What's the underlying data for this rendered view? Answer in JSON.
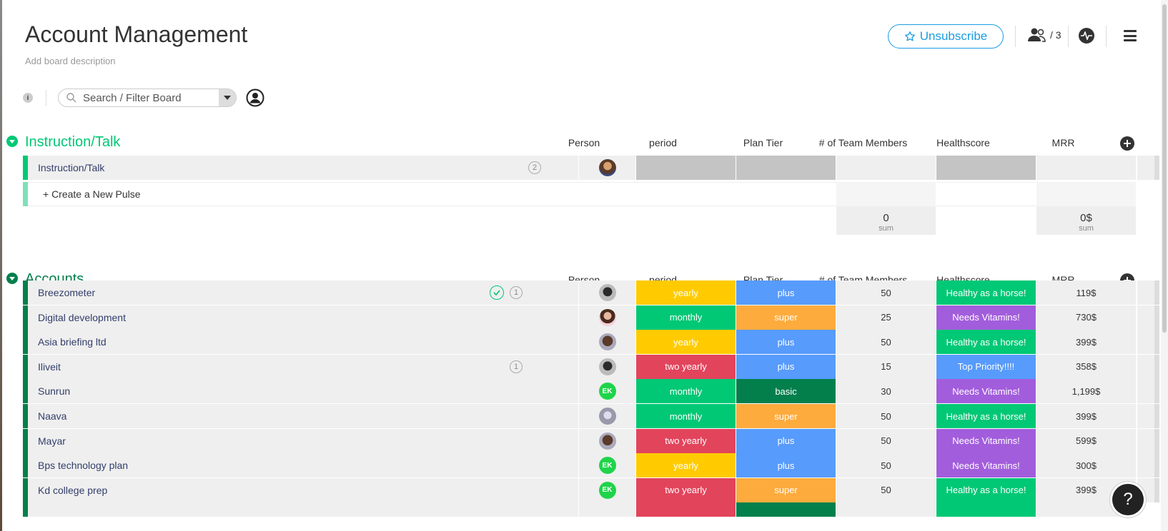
{
  "board": {
    "title": "Account Management",
    "description": "Add board description",
    "unsubscribe_label": "Unsubscribe",
    "members_count": "/ 3",
    "search_placeholder": "Search / Filter Board",
    "info_badge": "i"
  },
  "columns": [
    "Person",
    "period",
    "Plan Tier",
    "# of Team Members",
    "Healthscore",
    "MRR"
  ],
  "colors": {
    "yearly": "#ffcb00",
    "monthly": "#00c875",
    "two yearly": "#e2445c",
    "plus": "#579bfc",
    "super": "#fdab3d",
    "basic": "#037f4c",
    "Healthy as a horse!": "#00c875",
    "Needs Vitamins!": "#a25ddc",
    "Top Priority!!!!": "#579bfc",
    "group1": "#00c875",
    "group2": "#037f4c",
    "empty": "#c4c4c4"
  },
  "groups": [
    {
      "title": "Instruction/Talk",
      "rows": [
        {
          "name": "Instruction/Talk",
          "updates": "2",
          "person": "photo",
          "period": "",
          "tier": "",
          "team": "",
          "health": "",
          "mrr": ""
        }
      ],
      "new_pulse": "+ Create a New Pulse",
      "sums": {
        "team": "0",
        "mrr": "0$",
        "label": "sum"
      }
    },
    {
      "title": "Accounts",
      "rows": [
        {
          "name": "Breezometer",
          "updates": "1",
          "done": true,
          "person": "photo",
          "period": "yearly",
          "tier": "plus",
          "team": "50",
          "health": "Healthy as a horse!",
          "mrr": "119$"
        },
        {
          "name": "Digital development",
          "person": "photo",
          "period": "monthly",
          "tier": "super",
          "team": "25",
          "health": "Needs Vitamins!",
          "mrr": "730$"
        },
        {
          "name": "Asia briefing ltd",
          "person": "photo",
          "period": "yearly",
          "tier": "plus",
          "team": "50",
          "health": "Healthy as a horse!",
          "mrr": "399$"
        },
        {
          "name": "Iliveit",
          "updates": "1",
          "person": "photo",
          "period": "two yearly",
          "tier": "plus",
          "team": "15",
          "health": "Top Priority!!!!",
          "mrr": "358$"
        },
        {
          "name": "Sunrun",
          "person": "EK",
          "period": "monthly",
          "tier": "basic",
          "team": "30",
          "health": "Needs Vitamins!",
          "mrr": "1,199$"
        },
        {
          "name": "Naava",
          "person": "photo",
          "period": "monthly",
          "tier": "super",
          "team": "50",
          "health": "Healthy as a horse!",
          "mrr": "399$"
        },
        {
          "name": "Mayar",
          "person": "photo",
          "period": "two yearly",
          "tier": "plus",
          "team": "50",
          "health": "Needs Vitamins!",
          "mrr": "599$"
        },
        {
          "name": "Bps technology plan",
          "person": "EK",
          "period": "yearly",
          "tier": "plus",
          "team": "50",
          "health": "Needs Vitamins!",
          "mrr": "300$"
        },
        {
          "name": "Kd college prep",
          "person": "EK",
          "period": "two yearly",
          "tier": "super",
          "team": "50",
          "health": "Healthy as a horse!",
          "mrr": "399$"
        }
      ]
    }
  ],
  "help_label": "?"
}
